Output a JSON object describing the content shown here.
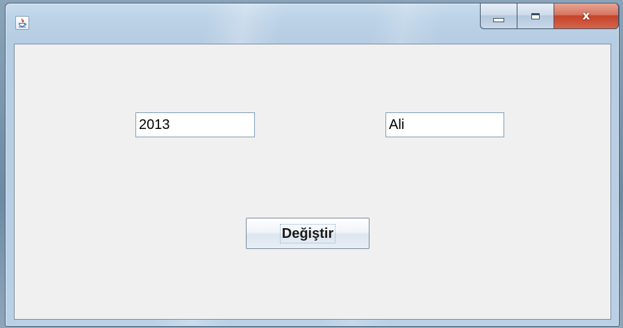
{
  "window": {
    "title": "",
    "icon": "java-coffee-icon",
    "controls": {
      "minimize": "minimize-icon",
      "maximize": "maximize-icon",
      "close_label": "x"
    }
  },
  "form": {
    "year_field_value": "2013",
    "name_field_value": "Ali",
    "change_button_label": "Değiştir"
  },
  "colors": {
    "close_button": "#c4432a",
    "client_background": "#f0f0f0",
    "field_border": "#7f9db9"
  }
}
